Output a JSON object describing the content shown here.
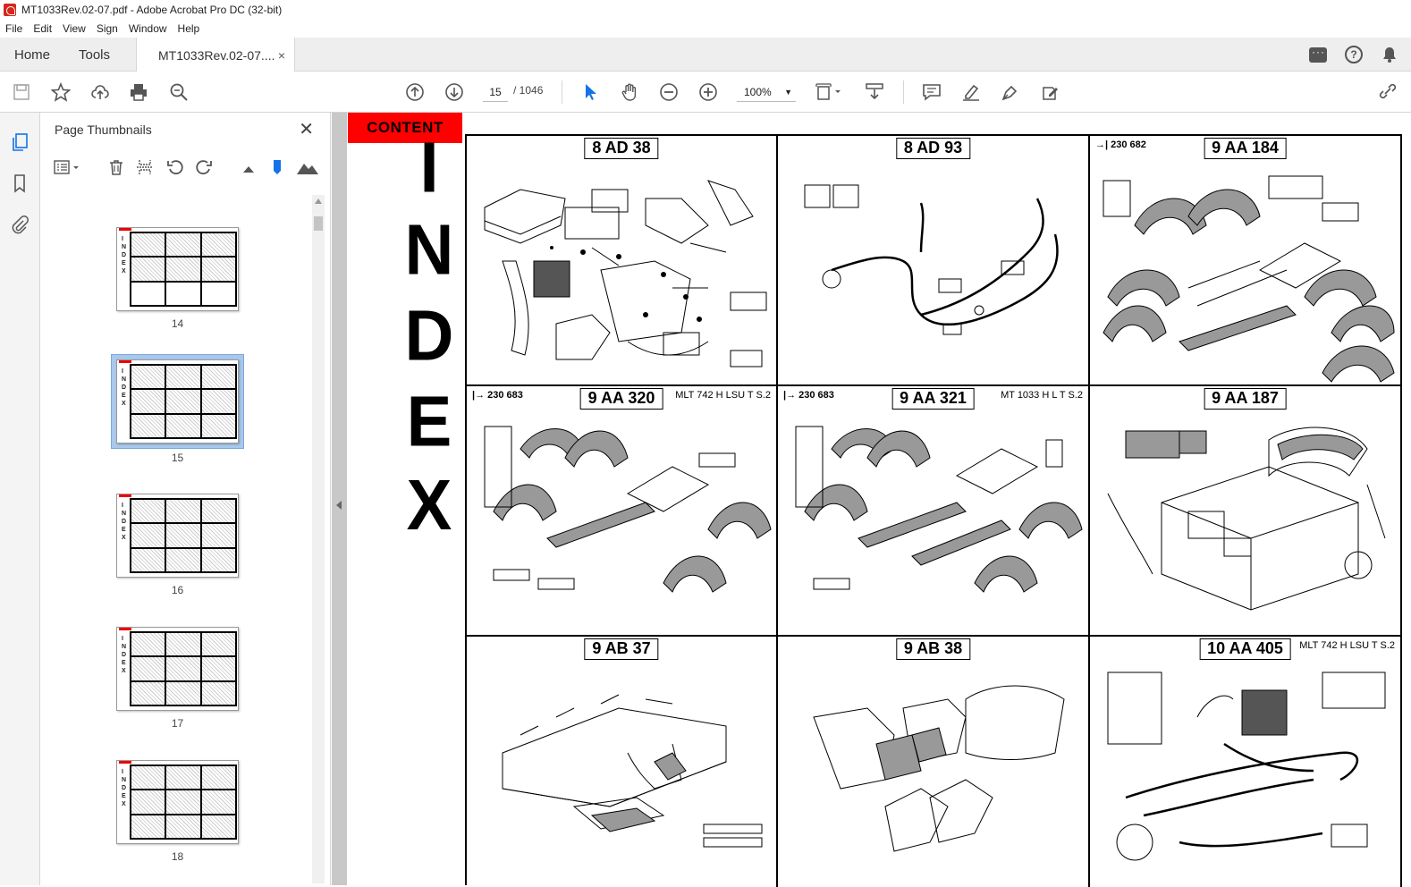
{
  "window": {
    "title": "MT1033Rev.02-07.pdf - Adobe Acrobat Pro DC (32-bit)"
  },
  "menu": [
    "File",
    "Edit",
    "View",
    "Sign",
    "Window",
    "Help"
  ],
  "tabs": {
    "home": "Home",
    "tools": "Tools",
    "document": "MT1033Rev.02-07....",
    "close": "×"
  },
  "toolbar": {
    "current_page": "15",
    "total_pages": "/ 1046",
    "zoom": "100%"
  },
  "thumbnails_panel": {
    "title": "Page Thumbnails",
    "close": "✕",
    "pages": [
      "14",
      "15",
      "16",
      "17",
      "18"
    ],
    "selected": "15"
  },
  "document": {
    "content_button": "CONTENT",
    "index_letters": [
      "I",
      "N",
      "D",
      "E",
      "X"
    ],
    "cells": [
      {
        "title": "8 AD 38",
        "ref": "",
        "model": ""
      },
      {
        "title": "8 AD 93",
        "ref": "",
        "model": ""
      },
      {
        "title": "9 AA 184",
        "ref": "→| 230 682",
        "model": ""
      },
      {
        "title": "9 AA 320",
        "ref": "|→ 230 683",
        "model": "MLT 742 H LSU T S.2"
      },
      {
        "title": "9 AA 321",
        "ref": "|→ 230 683",
        "model": "MT 1033 H L T S.2"
      },
      {
        "title": "9 AA 187",
        "ref": "",
        "model": ""
      },
      {
        "title": "9 AB 37",
        "ref": "",
        "model": ""
      },
      {
        "title": "9 AB 38",
        "ref": "",
        "model": ""
      },
      {
        "title": "10 AA 405",
        "ref": "",
        "model": "MLT 742 H LSU T S.2"
      }
    ]
  },
  "colors": {
    "accent": "#1473e6",
    "content_button": "#ff0000",
    "selection": "#a9c8ec"
  }
}
